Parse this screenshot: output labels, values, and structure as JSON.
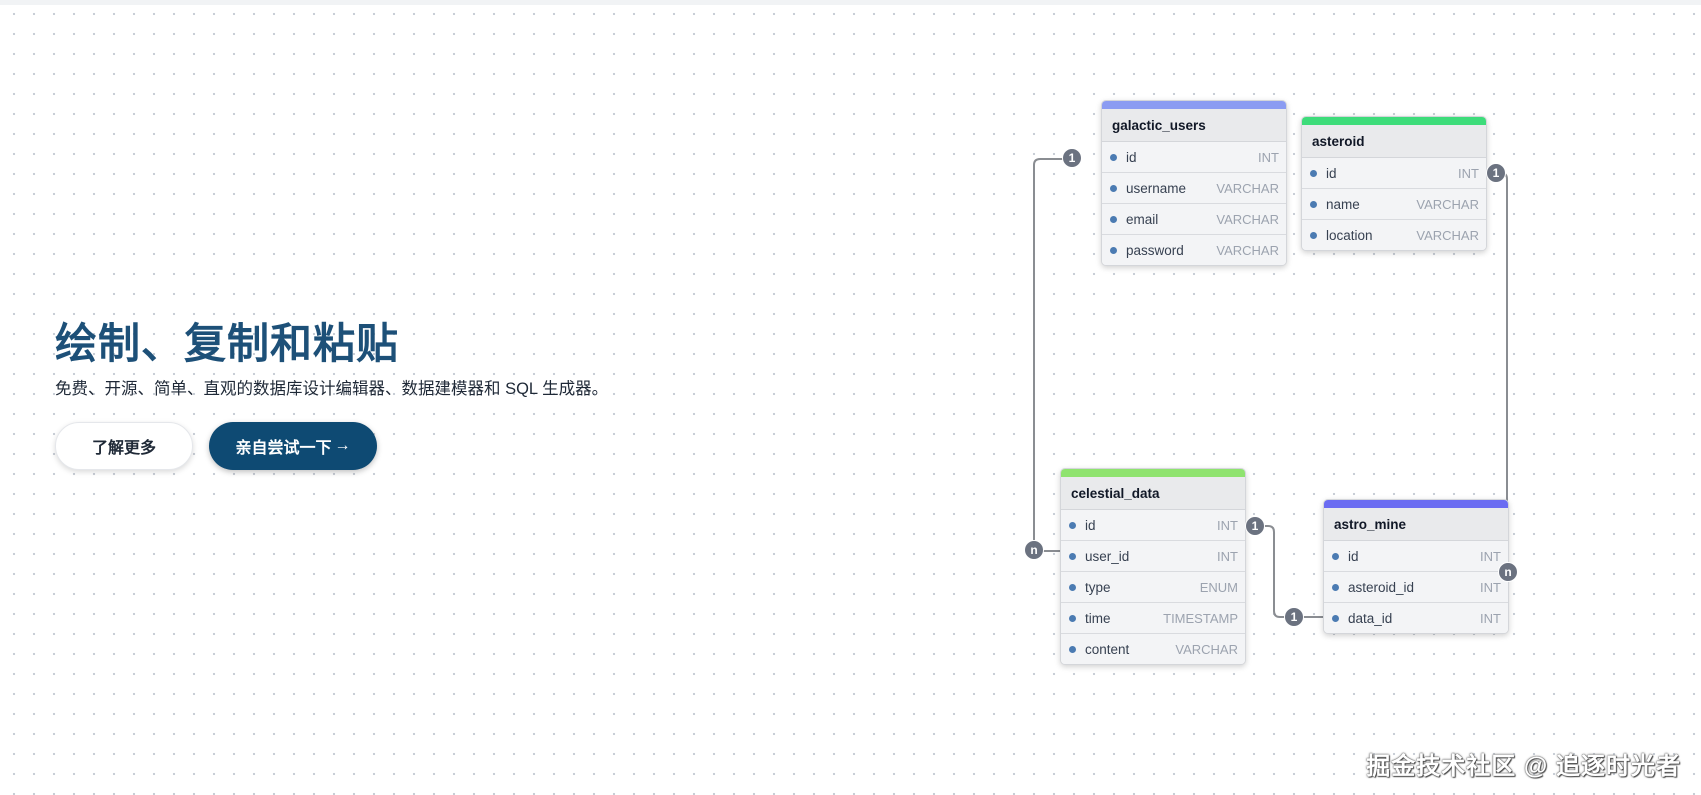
{
  "hero": {
    "title": "绘制、复制和粘贴",
    "subtitle": "免费、开源、简单、直观的数据库设计编辑器、数据建模器和 SQL 生成器。",
    "learn_more_label": "了解更多",
    "try_label": "亲自尝试一下",
    "try_arrow": "→"
  },
  "colors": {
    "title": "#1d5078",
    "primary_button": "#0e4a73",
    "galactic_users_bar": "#8b9cf2",
    "asteroid_bar": "#3ddc7a",
    "celestial_data_bar": "#8fe36f",
    "astro_mine_bar": "#6b6cf2",
    "field_dot": "#4b7bb2",
    "relation_line": "#8a8d92"
  },
  "tables": {
    "galactic_users": {
      "name": "galactic_users",
      "fields": [
        {
          "name": "id",
          "type": "INT"
        },
        {
          "name": "username",
          "type": "VARCHAR"
        },
        {
          "name": "email",
          "type": "VARCHAR"
        },
        {
          "name": "password",
          "type": "VARCHAR"
        }
      ]
    },
    "asteroid": {
      "name": "asteroid",
      "fields": [
        {
          "name": "id",
          "type": "INT"
        },
        {
          "name": "name",
          "type": "VARCHAR"
        },
        {
          "name": "location",
          "type": "VARCHAR"
        }
      ]
    },
    "celestial_data": {
      "name": "celestial_data",
      "fields": [
        {
          "name": "id",
          "type": "INT"
        },
        {
          "name": "user_id",
          "type": "INT"
        },
        {
          "name": "type",
          "type": "ENUM"
        },
        {
          "name": "time",
          "type": "TIMESTAMP"
        },
        {
          "name": "content",
          "type": "VARCHAR"
        }
      ]
    },
    "astro_mine": {
      "name": "astro_mine",
      "fields": [
        {
          "name": "id",
          "type": "INT"
        },
        {
          "name": "asteroid_id",
          "type": "INT"
        },
        {
          "name": "data_id",
          "type": "INT"
        }
      ]
    }
  },
  "relations": {
    "users_one": "1",
    "data_many": "n",
    "asteroid_one": "1",
    "mine_many": "n",
    "data_one": "1",
    "mine_one": "1"
  },
  "watermark": "掘金技术社区 @ 追逐时光者"
}
